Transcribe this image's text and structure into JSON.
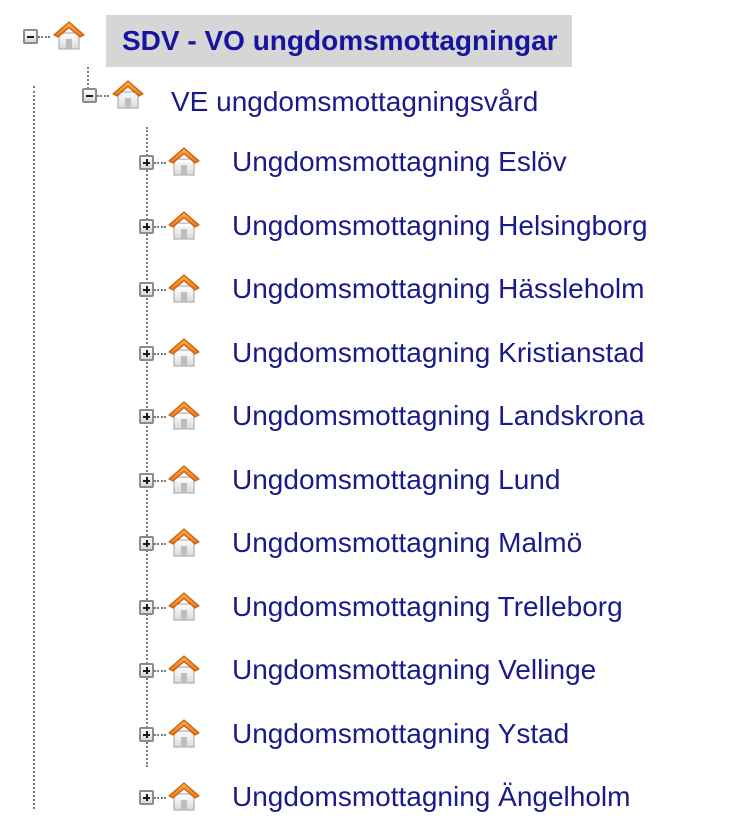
{
  "tree": {
    "root": {
      "label": "SDV - VO ungdomsmottagningar",
      "expanded": true
    },
    "level1": {
      "label": "VE ungdomsmottagningsvård",
      "expanded": true
    },
    "children": [
      {
        "label": "Ungdomsmottagning Eslöv"
      },
      {
        "label": "Ungdomsmottagning Helsingborg"
      },
      {
        "label": "Ungdomsmottagning Hässleholm"
      },
      {
        "label": "Ungdomsmottagning Kristianstad"
      },
      {
        "label": "Ungdomsmottagning Landskrona"
      },
      {
        "label": "Ungdomsmottagning Lund"
      },
      {
        "label": "Ungdomsmottagning Malmö"
      },
      {
        "label": "Ungdomsmottagning Trelleborg"
      },
      {
        "label": "Ungdomsmottagning Vellinge"
      },
      {
        "label": "Ungdomsmottagning Ystad"
      },
      {
        "label": "Ungdomsmottagning Ängelholm"
      }
    ]
  },
  "icons": {
    "node": "house-icon",
    "expand": "plus-icon",
    "collapse": "minus-icon"
  },
  "colors": {
    "label": "#1a1a8c",
    "selected_bg": "#d6d6d6",
    "house_roof": "#f08a24"
  }
}
